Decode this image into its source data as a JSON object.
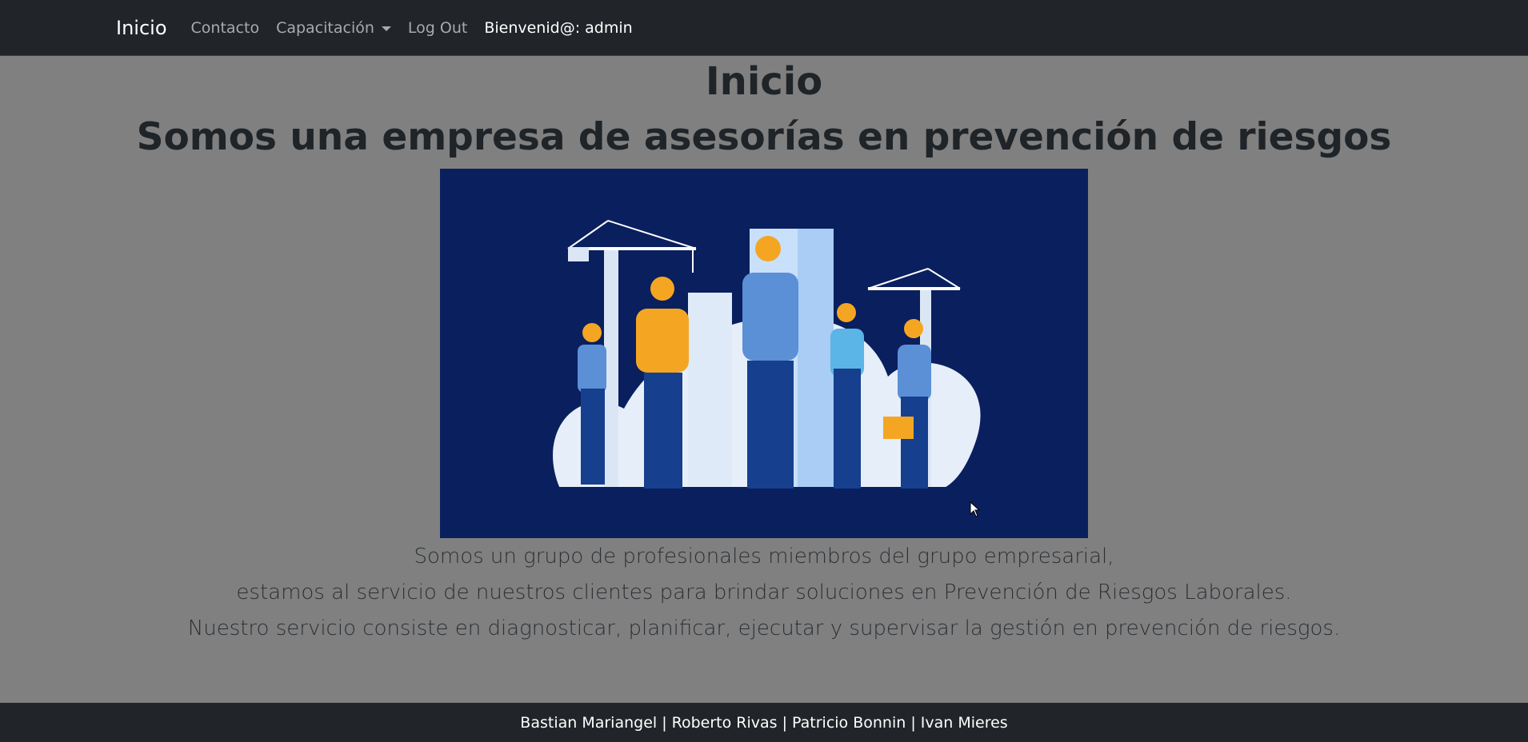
{
  "navbar": {
    "brand": "Inicio",
    "links": {
      "contacto": "Contacto",
      "capacitacion": "Capacitación",
      "logout": "Log Out"
    },
    "welcome": "Bienvenid@: admin"
  },
  "main": {
    "title": "Inicio",
    "subtitle": "Somos una empresa de asesorías en prevención de riesgos",
    "hero_image": "construction-workers-illustration",
    "paragraphs": [
      "Somos un grupo de profesionales miembros del grupo empresarial,",
      "estamos al servicio de nuestros clientes para brindar soluciones en Prevención de Riesgos Laborales.",
      "Nuestro servicio consiste en diagnosticar, planificar, ejecutar y supervisar la gestión en prevención de riesgos."
    ]
  },
  "footer": {
    "credits": "Bastian Mariangel | Roberto Rivas | Patricio Bonnin | Ivan Mieres"
  },
  "colors": {
    "navbar_bg": "#212529",
    "page_bg": "#808080",
    "hero_bg": "#0a1f5e",
    "helmet": "#f4a623"
  }
}
